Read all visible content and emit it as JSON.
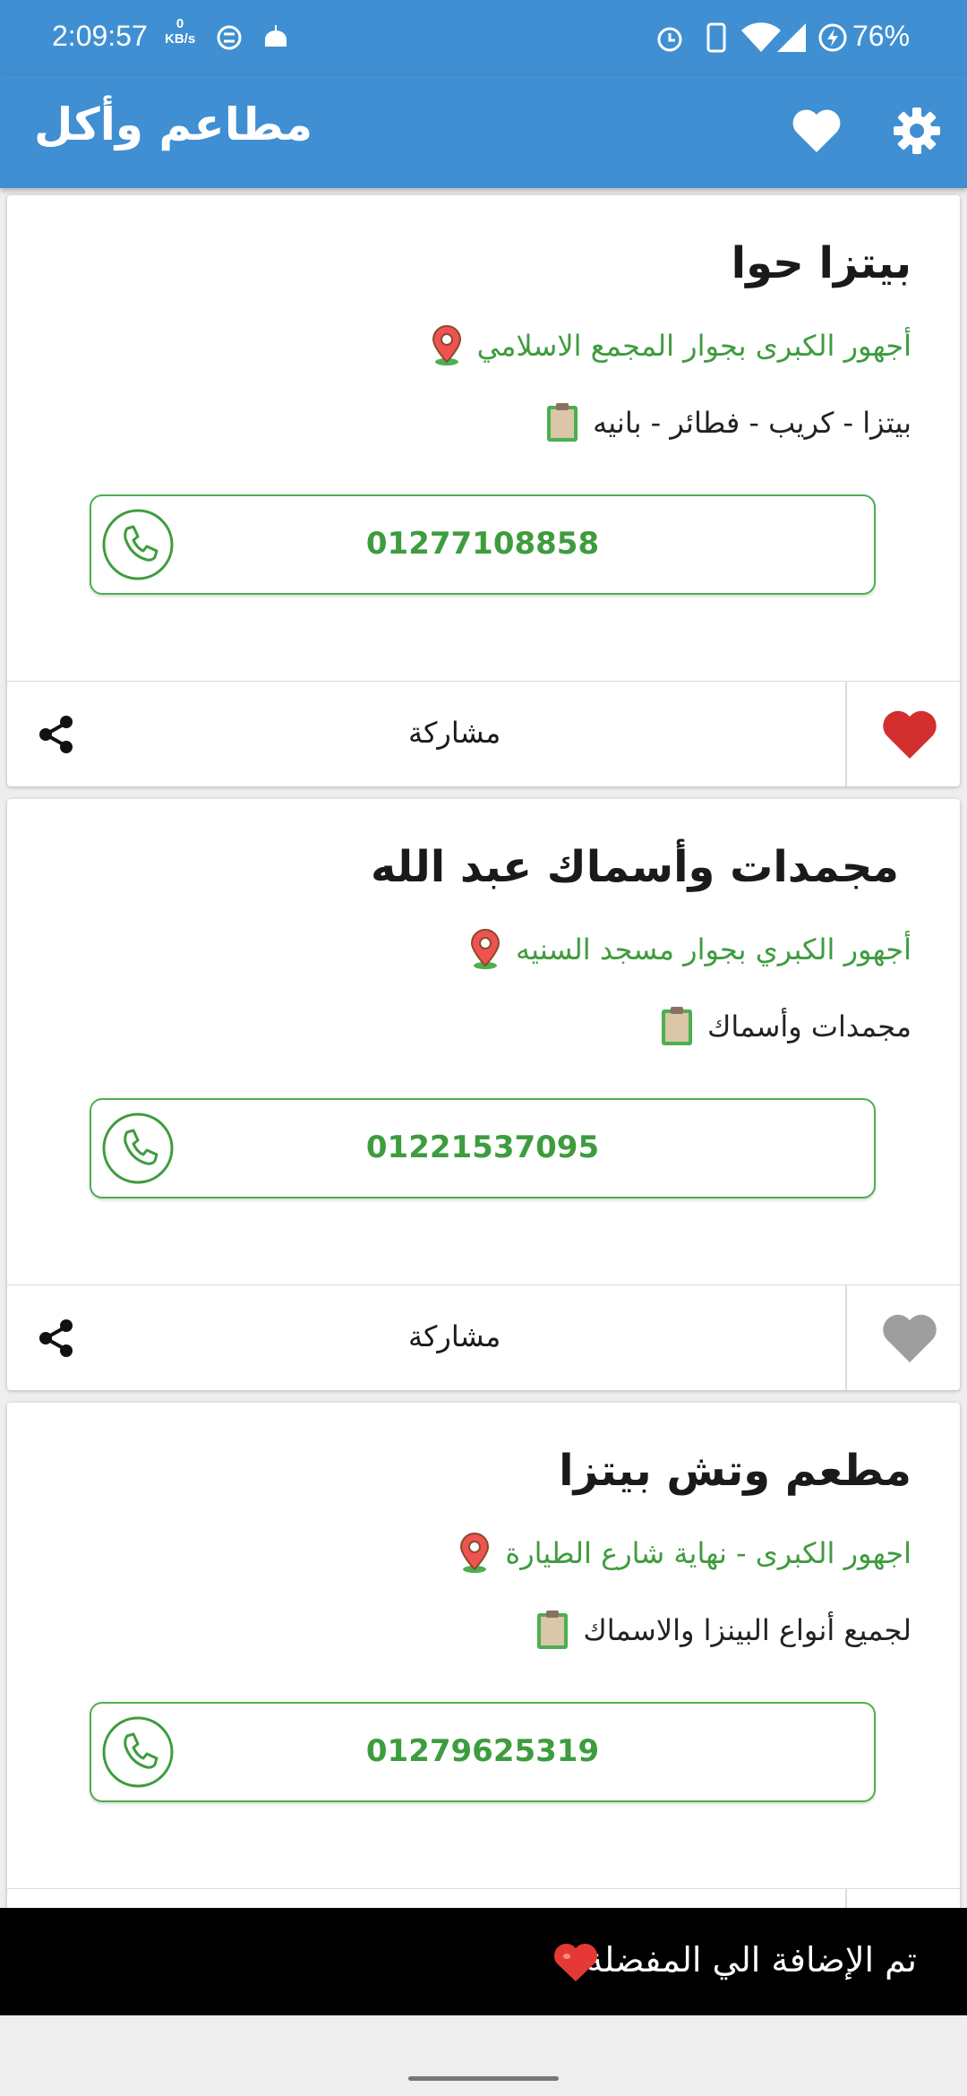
{
  "status_bar": {
    "time": "2:09:57",
    "net_speed_value": "0",
    "net_speed_unit": "KB/s",
    "battery": "76%"
  },
  "app_bar": {
    "title": "مطاعم وأكل",
    "icons": [
      "heart-icon",
      "settings-icon"
    ],
    "color": "#3f8fd2"
  },
  "restaurants": [
    {
      "name": "بيتزا حوا",
      "address": "أجهور الكبرى بجوار المجمع الاسلامي",
      "menu": "بيتزا - كريب - فطائر - بانيه",
      "phone": "01277108858",
      "share_label": "مشاركة",
      "favorite": true
    },
    {
      "name": "مجمدات وأسماك عبد الله",
      "address": "أجهور الكبري بجوار مسجد السنيه",
      "menu": "مجمدات وأسماك",
      "phone": "01221537095",
      "share_label": "مشاركة",
      "favorite": false
    },
    {
      "name": "مطعم وتش بيتزا",
      "address": "اجهور الكبرى - نهاية شارع الطيارة",
      "menu": "لجميع أنواع البينزا والاسماك",
      "phone": "01279625319",
      "share_label": "مشاركة",
      "favorite": false
    }
  ],
  "snackbar": {
    "message": "تم الإضافة الي المفضلة"
  },
  "colors": {
    "accent_green": "#3e9c3e",
    "favorite_red": "#d32f2f",
    "favorite_grey": "#9e9e9e"
  }
}
